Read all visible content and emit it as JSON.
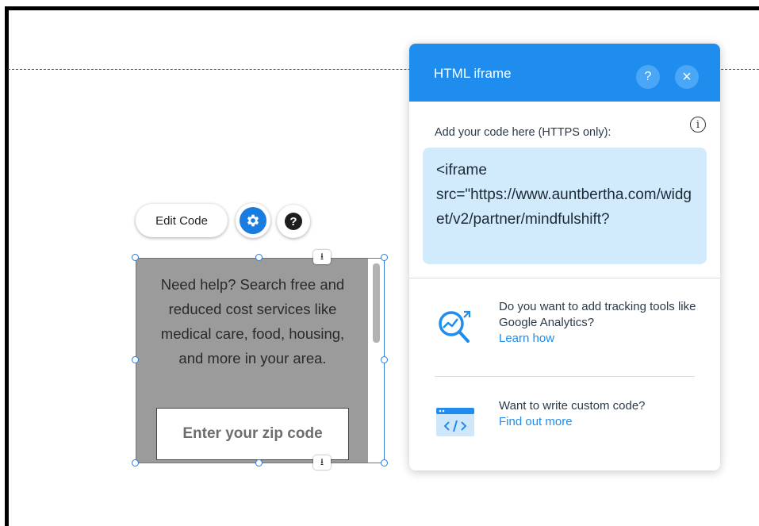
{
  "element_toolbar": {
    "edit_code_label": "Edit Code",
    "settings_icon": "gear-icon",
    "help_label": "?"
  },
  "widget": {
    "description": "Need help? Search free and reduced cost services like medical care, food, housing, and more in your area.",
    "zip_placeholder": "Enter your zip code",
    "anchor_glyph": "⭳"
  },
  "panel": {
    "title": "HTML iframe",
    "help_label": "?",
    "close_label": "×",
    "code_label": "Add your code here (HTTPS only):",
    "info_glyph": "i",
    "code_value": "<iframe\nsrc=\"https://www.auntbertha.com/widget/v2/partner/mindfulshift?",
    "tracking": {
      "text": "Do you want to add tracking tools like Google Analytics?",
      "link": "Learn how"
    },
    "custom_code": {
      "text": "Want to write custom code?",
      "link": "Find out more"
    }
  },
  "colors": {
    "accent": "#1f8ded",
    "widget_bg": "#9b9b9b",
    "code_bg": "#d2ebfc"
  }
}
